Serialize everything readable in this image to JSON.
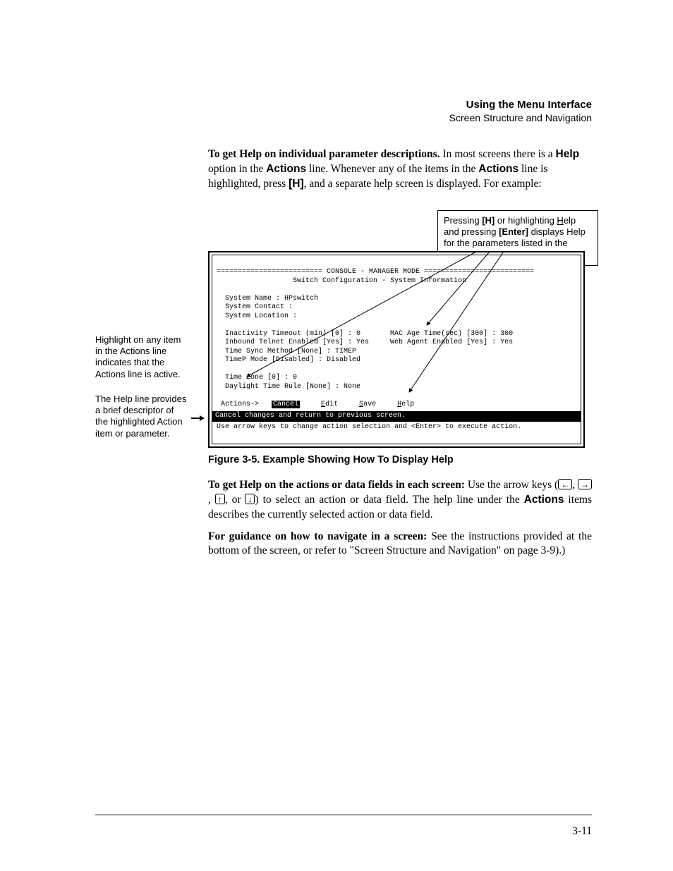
{
  "runningHead": {
    "chapter": "Using the Menu Interface",
    "section": "Screen Structure and Navigation"
  },
  "para1": {
    "lead": "To get Help on individual parameter descriptions.",
    "t1": "  In most screens there is a ",
    "helpWord": "Help",
    "t2": " option in the ",
    "actionsWord1": "Actions",
    "t3": " line. Whenever any of the items in the ",
    "actionsWord2": "Actions",
    "t4": " line is highlighted, press ",
    "keyH": "[H]",
    "t5": ", and a separate help screen is displayed. For example:"
  },
  "annotBox": {
    "t1": "Pressing ",
    "keyH": "[H]",
    "t2": " or highlighting ",
    "helpWordU": "H",
    "helpWordRest": "elp and pressing ",
    "keyEnter": "[Enter]",
    "t3": " displays Help for the parameters listed in the upper part of the screen"
  },
  "callout1": "Highlight  on any item in the Actions line indicates that the Actions line is active.",
  "callout2": "The Help line provides a brief descriptor of the highlighted Action item or parameter.",
  "terminal": {
    "line1pre": "========================= ",
    "line1mid": "CONSOLE - MANAGER MODE",
    "line1post": " ==========================",
    "line2": "                  Switch Configuration - System Information",
    "blank": " ",
    "sysName": "  System Name : HPswitch",
    "sysContact": "  System Contact :",
    "sysLoc": "  System Location :",
    "inactL": "  Inactivity Timeout (min) [0] : 0",
    "inactR": "       MAC Age Time(sec) [300] : 300",
    "telnetL": "  Inbound Telnet Enabled [Yes] : Yes",
    "telnetR": "     Web Agent Enabled [Yes] : Yes",
    "tsync": "  Time Sync Method [None] : TIMEP",
    "timep": "  TimeP Mode [Disabled] : Disabled",
    "tz": "  Time Zone [0] : 0",
    "dst": "  Daylight Time Rule [None] : None",
    "actionsPrefix": " Actions->   ",
    "actCancel": "Cancel",
    "gap1": "     ",
    "actEditU": "E",
    "actEditRest": "dit",
    "gap2": "     ",
    "actSaveU": "S",
    "actSaveRest": "ave",
    "gap3": "     ",
    "actHelpU": "H",
    "actHelpRest": "elp",
    "status": "Cancel changes and return to previous screen.",
    "hint": "Use arrow keys to change action selection and <Enter> to execute action."
  },
  "figureCaption": "Figure 3-5.    Example Showing How To Display Help",
  "para2": {
    "lead": "To get Help on the actions or data fields in each screen:",
    "t1": " Use the arrow keys (",
    "kLeft": "←",
    "kRight": "→",
    "kUp": "↑",
    "kDown": "↓",
    "sep": ", ",
    "or": ", or ",
    "t2": ") to select an action or data field. The help line under the ",
    "actionsWord": "Actions",
    "t3": " items describes the currently selected action or data field."
  },
  "para3": {
    "lead": "For guidance on how to navigate in a screen:",
    "body": " See the instructions provided at the bottom of the screen, or refer to \"Screen Structure and Navigation\" on page 3-9).)"
  },
  "folio": "3-11"
}
